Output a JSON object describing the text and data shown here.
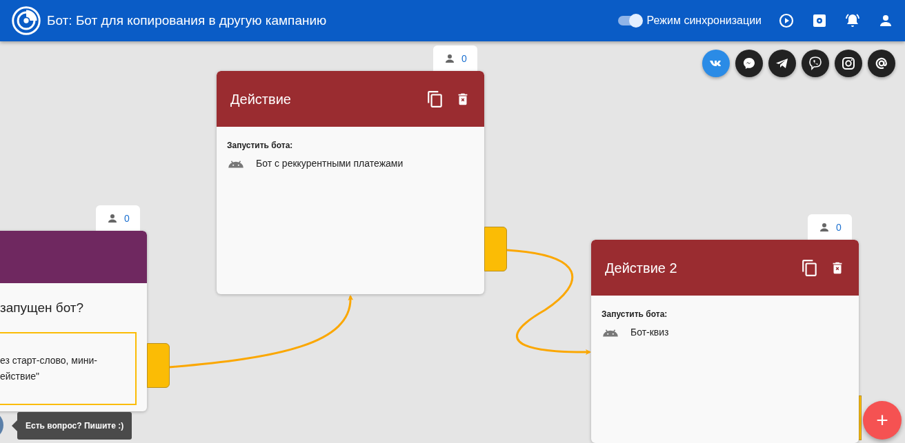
{
  "header": {
    "title": "Бот: Бот для копирования в другую кампанию",
    "sync_toggle": {
      "label": "Режим синхронизации",
      "on": true
    }
  },
  "channels": [
    {
      "kind": "vk",
      "selected": true
    },
    {
      "kind": "messenger",
      "selected": false
    },
    {
      "kind": "telegram",
      "selected": false
    },
    {
      "kind": "viber",
      "selected": false
    },
    {
      "kind": "instagram",
      "selected": false
    },
    {
      "kind": "email",
      "selected": false
    }
  ],
  "nodes": [
    {
      "kind": "condition",
      "counter": "0",
      "question": "запущен бот?",
      "option_lines": [
        "ез старт-слово, мини-",
        "ействие\""
      ]
    },
    {
      "kind": "action",
      "counter": "0",
      "title": "Действие",
      "label": "Запустить бота:",
      "bot": "Бот с реккурентными платежами"
    },
    {
      "kind": "action",
      "counter": "0",
      "title": "Действие 2",
      "label": "Запустить бота:",
      "bot": "Бот-квиз"
    }
  ],
  "chat_tooltip": "Есть вопрос? Пишите :)",
  "add_button": "+"
}
